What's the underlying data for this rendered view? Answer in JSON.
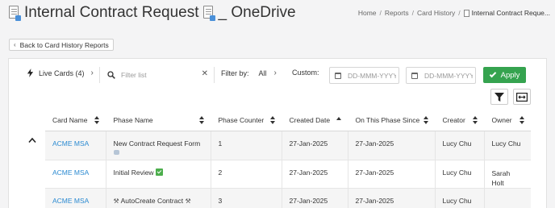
{
  "header": {
    "title_part1": "Internal Contract Request",
    "title_part2": "_ OneDrive",
    "breadcrumb": [
      "Home",
      "Reports",
      "Card History"
    ],
    "breadcrumb_current": "Internal Contract Reque..."
  },
  "back_button_label": "Back to Card History Reports",
  "toolbar": {
    "live_cards_label": "Live Cards (4)",
    "search_placeholder": "Filter list",
    "filter_by_label": "Filter by:",
    "filter_by_value": "All",
    "custom_label": "Custom:",
    "date_from_placeholder": "DD-MMM-YYYY",
    "date_to_placeholder": "DD-MMM-YYYY",
    "apply_label": "Apply",
    "apply_color": "#35a34f"
  },
  "table": {
    "columns": [
      "Card Name",
      "Phase Name",
      "Phase Counter",
      "Created Date",
      "On This Phase Since",
      "Creator",
      "Owner"
    ],
    "rows": [
      {
        "card_name": "ACME MSA",
        "phase_name": "New Contract Request Form",
        "phase_icon": "robot-emoji",
        "phase_counter": "1",
        "created_date": "27-Jan-2025",
        "on_phase_since": "27-Jan-2025",
        "creator": "Lucy Chu",
        "owner": "Lucy Chu"
      },
      {
        "card_name": "ACME MSA",
        "phase_name": "Initial Review",
        "phase_icon": "check-mark-emoji",
        "phase_counter": "2",
        "created_date": "27-Jan-2025",
        "on_phase_since": "27-Jan-2025",
        "creator": "Lucy Chu",
        "owner": "Sarah Holt"
      },
      {
        "card_name": "ACME MSA",
        "phase_name": "AutoCreate Contract",
        "phase_icon": "tools-emoji",
        "phase_counter": "3",
        "created_date": "27-Jan-2025",
        "on_phase_since": "27-Jan-2025",
        "creator": "Lucy Chu",
        "owner": ""
      }
    ]
  },
  "colors": {
    "link": "#2b8ad1",
    "accent_green": "#35a34f"
  }
}
